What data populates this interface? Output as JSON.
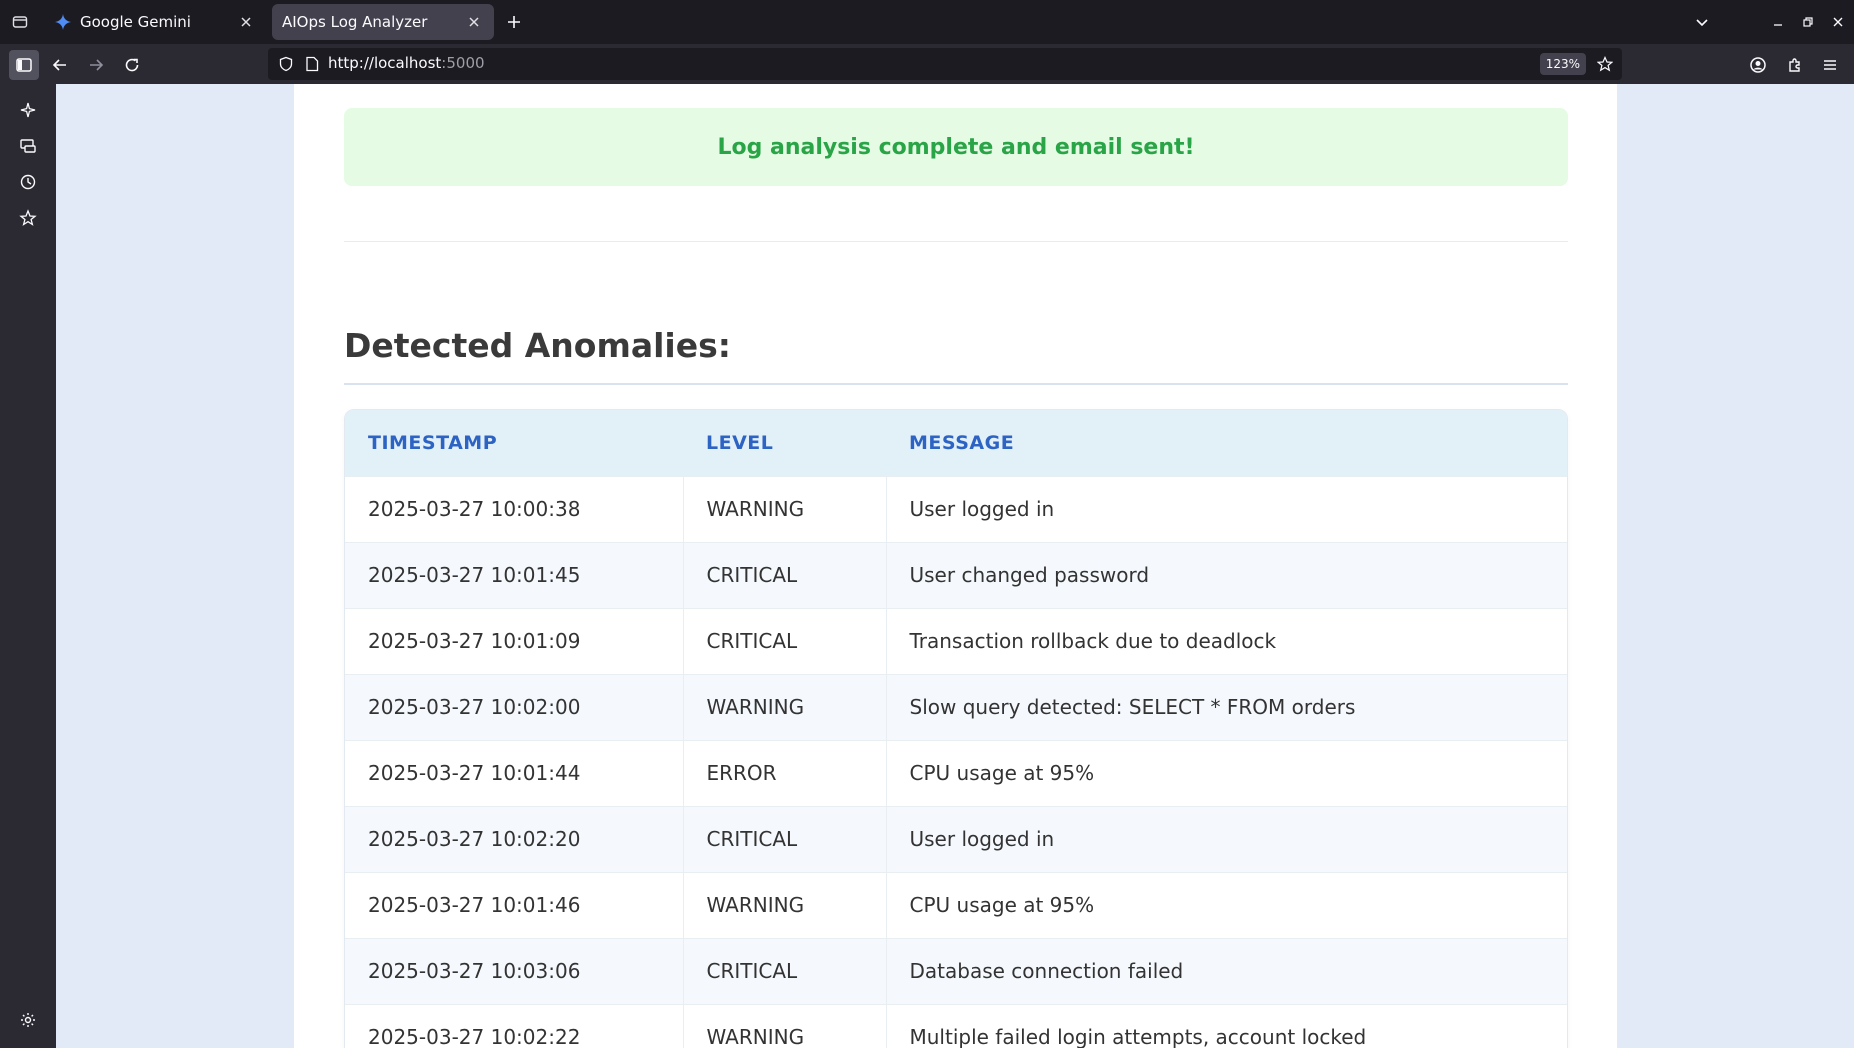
{
  "browser": {
    "tabs": [
      {
        "label": "Google Gemini",
        "icon": "gemini-icon",
        "active": false
      },
      {
        "label": "AIOps Log Analyzer",
        "icon": "",
        "active": true
      }
    ],
    "url_scheme_host": "http://localhost",
    "url_port": ":5000",
    "zoom": "123%"
  },
  "page": {
    "success_message": "Log analysis complete and email sent!",
    "section_title": "Detected Anomalies:",
    "table": {
      "headers": [
        "TIMESTAMP",
        "LEVEL",
        "MESSAGE"
      ],
      "rows": [
        [
          "2025-03-27 10:00:38",
          "WARNING",
          "User logged in"
        ],
        [
          "2025-03-27 10:01:45",
          "CRITICAL",
          "User changed password"
        ],
        [
          "2025-03-27 10:01:09",
          "CRITICAL",
          "Transaction rollback due to deadlock"
        ],
        [
          "2025-03-27 10:02:00",
          "WARNING",
          "Slow query detected: SELECT * FROM orders"
        ],
        [
          "2025-03-27 10:01:44",
          "ERROR",
          "CPU usage at 95%"
        ],
        [
          "2025-03-27 10:02:20",
          "CRITICAL",
          "User logged in"
        ],
        [
          "2025-03-27 10:01:46",
          "WARNING",
          "CPU usage at 95%"
        ],
        [
          "2025-03-27 10:03:06",
          "CRITICAL",
          "Database connection failed"
        ],
        [
          "2025-03-27 10:02:22",
          "WARNING",
          "Multiple failed login attempts, account locked"
        ]
      ]
    }
  },
  "colors": {
    "success_text": "#29a447",
    "success_bg": "#e5fbe3",
    "header_text": "#2d64c3",
    "header_bg": "#e2f0f8",
    "page_bg": "#e3eaf7"
  }
}
